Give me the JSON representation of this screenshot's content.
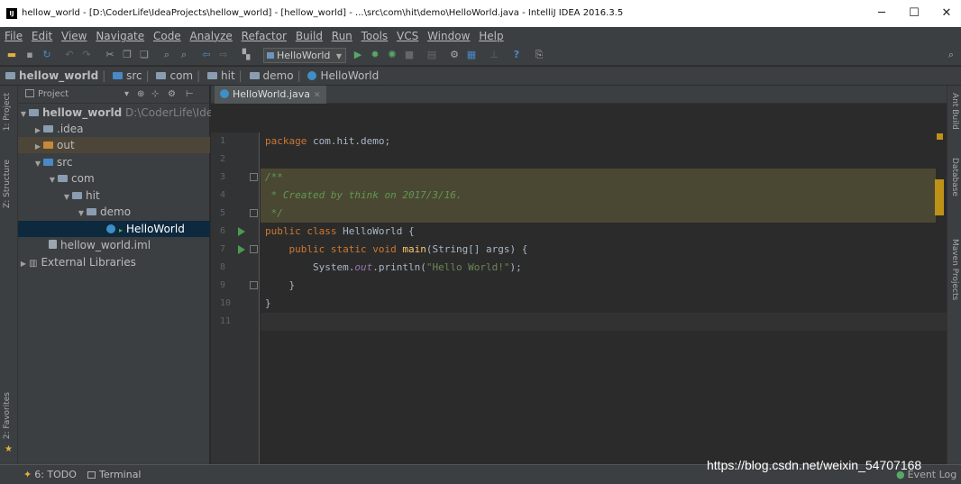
{
  "window": {
    "title": "hellow_world - [D:\\CoderLife\\IdeaProjects\\hellow_world] - [hellow_world] - ...\\src\\com\\hit\\demo\\HelloWorld.java - IntelliJ IDEA 2016.3.5",
    "app_icon_letter": "IJ",
    "minimize": "─",
    "maximize": "☐",
    "close": "✕"
  },
  "menu": [
    "File",
    "Edit",
    "View",
    "Navigate",
    "Code",
    "Analyze",
    "Refactor",
    "Build",
    "Run",
    "Tools",
    "VCS",
    "Window",
    "Help"
  ],
  "toolbar": {
    "run_config": "HelloWorld"
  },
  "breadcrumb": [
    "hellow_world",
    "src",
    "com",
    "hit",
    "demo",
    "HelloWorld"
  ],
  "side_tabs": {
    "project": "1: Project",
    "structure": "Z: Structure",
    "favorites": "2: Favorites"
  },
  "right_tabs": {
    "ant": "Ant Build",
    "database": "Database",
    "maven": "Maven Projects"
  },
  "project_panel": {
    "title": "Project",
    "tree": [
      {
        "label": "hellow_world",
        "extra": "D:\\CoderLife\\IdeaP"
      },
      {
        "label": ".idea"
      },
      {
        "label": "out"
      },
      {
        "label": "src"
      },
      {
        "label": "com"
      },
      {
        "label": "hit"
      },
      {
        "label": "demo"
      },
      {
        "label": "HelloWorld"
      },
      {
        "label": "hellow_world.iml"
      },
      {
        "label": "External Libraries"
      }
    ]
  },
  "editor": {
    "tab": "HelloWorld.java",
    "line_numbers": [
      "1",
      "2",
      "3",
      "4",
      "5",
      "6",
      "7",
      "8",
      "9",
      "10",
      "11"
    ],
    "lines": {
      "l1_kw": "package",
      "l1_rest": " com.hit.demo;",
      "l3": "/**",
      "l4": " * Created by think on 2017/3/16.",
      "l5": " */",
      "l6_kw": "public class",
      "l6_rest": " HelloWorld {",
      "l7_kw": "    public static void",
      "l7_fn": " main",
      "l7_rest": "(String[] args) {",
      "l8_a": "        System.",
      "l8_out": "out",
      "l8_b": ".println(",
      "l8_str": "\"Hello World!\"",
      "l8_c": ");",
      "l9": "    }",
      "l10": "}"
    }
  },
  "statusbar": {
    "todo": "6: TODO",
    "terminal": "Terminal",
    "event_log": "Event Log"
  },
  "watermark": "https://blog.csdn.net/weixin_54707168",
  "colors": {
    "keyword": "#cc7832",
    "comment": "#629755",
    "string": "#6a8759",
    "highlight": "#4a4832",
    "run_arrow": "#499c54",
    "marker": "#be9117"
  }
}
